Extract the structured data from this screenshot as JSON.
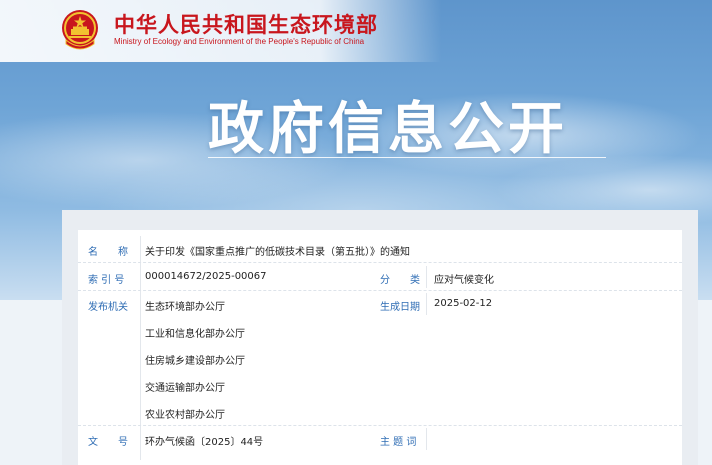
{
  "header": {
    "site_name_cn": "中华人民共和国生态环境部",
    "site_name_en": "Ministry of Ecology and Environment of the People's Republic of China",
    "banner_title": "政府信息公开"
  },
  "info": {
    "name_label": "名　　称",
    "name_value": "关于印发《国家重点推广的低碳技术目录（第五批）》的通知",
    "index_label": "索 引 号",
    "index_value": "000014672/2025-00067",
    "category_label": "分　　类",
    "category_value": "应对气候变化",
    "issuer_label": "发布机关",
    "issuers": [
      "生态环境部办公厅",
      "工业和信息化部办公厅",
      "住房城乡建设部办公厅",
      "交通运输部办公厅",
      "农业农村部办公厅"
    ],
    "date_label": "生成日期",
    "date_value": "2025-02-12",
    "docno_label": "文　　号",
    "docno_value": "环办气候函〔2025〕44号",
    "subject_label": "主 题 词",
    "subject_value": ""
  },
  "colors": {
    "brand_red": "#c8161d",
    "label_blue": "#2f6db4"
  }
}
